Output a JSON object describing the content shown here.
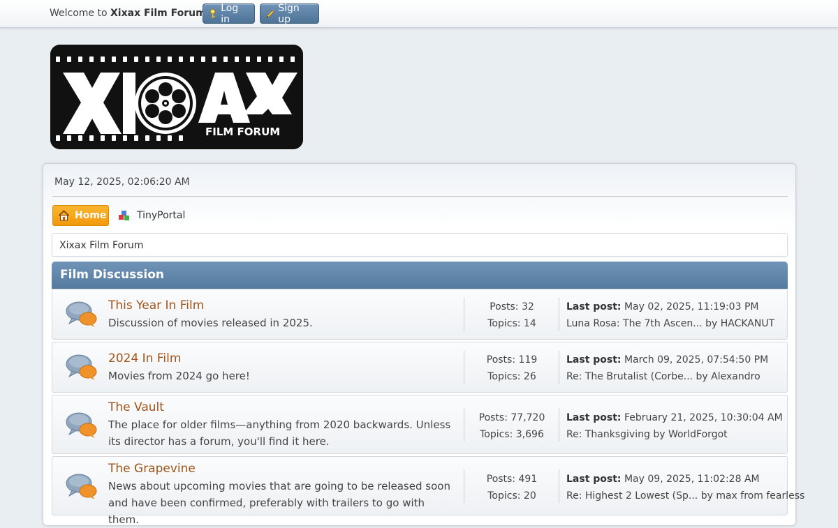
{
  "topbar": {
    "welcome_prefix": "Welcome to ",
    "forum_name": "Xixax Film Forum",
    "welcome_suffix": ".",
    "login_label": "Log in",
    "signup_label": "Sign up"
  },
  "logo": {
    "text_main": "XIXAX",
    "text_sub": "FILM FORUM"
  },
  "date_line": "May 12, 2025, 02:06:20 AM",
  "nav": {
    "home_label": "Home",
    "tinyportal_label": "TinyPortal"
  },
  "breadcrumb": "Xixax Film Forum",
  "category": {
    "title": "Film Discussion"
  },
  "boards": [
    {
      "title": "This Year In Film",
      "desc": "Discussion of movies released in 2025.",
      "posts": "Posts: 32",
      "topics": "Topics: 14",
      "last_label": "Last post:",
      "last_date": " May 02, 2025, 11:19:03 PM",
      "last_topic": "Luna Rosa: The 7th Ascen... by HACKANUT"
    },
    {
      "title": "2024 In Film",
      "desc": "Movies from 2024 go here!",
      "posts": "Posts: 119",
      "topics": "Topics: 26",
      "last_label": "Last post:",
      "last_date": " March 09, 2025, 07:54:50 PM",
      "last_topic": "Re: The Brutalist (Corbe... by Alexandro"
    },
    {
      "title": "The Vault",
      "desc": "The place for older films—anything from 2020 backwards. Unless its director has a forum, you'll find it here.",
      "posts": "Posts: 77,720",
      "topics": "Topics: 3,696",
      "last_label": "Last post:",
      "last_date": " February 21, 2025, 10:30:04 AM",
      "last_topic": "Re: Thanksgiving by WorldForgot"
    },
    {
      "title": "The Grapevine",
      "desc": "News about upcoming movies that are going to be released soon and have been confirmed, preferably with trailers to go with them.",
      "posts": "Posts: 491",
      "topics": "Topics: 20",
      "last_label": "Last post:",
      "last_date": " May 09, 2025, 11:02:28 AM",
      "last_topic": "Re: Highest 2 Lowest (Sp... by max from fearless"
    }
  ]
}
